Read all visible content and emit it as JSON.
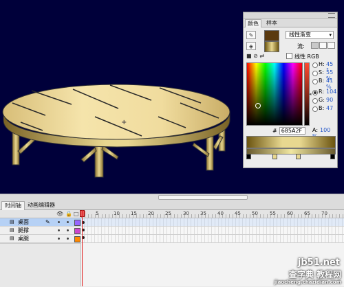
{
  "colors": {
    "stage_bg": "#00003a",
    "table_top_light": "#f2dea0",
    "table_top_dark": "#b79a52",
    "table_outline": "#333333",
    "accent_blue": "#2255c8",
    "playhead": "#e02020"
  },
  "color_panel": {
    "tabs": [
      "颜色",
      "样本"
    ],
    "active_tab": "颜色",
    "stroke_icon": "pencil-icon",
    "fill_icon": "paint-bucket-icon",
    "type_select": "线性渐变",
    "flow_label": "流:",
    "linear_rgb_label": "线性 RGB",
    "hsb": [
      {
        "label": "H:",
        "value": "45",
        "unit": "°"
      },
      {
        "label": "S:",
        "value": "55",
        "unit": "%"
      },
      {
        "label": "B:",
        "value": "41",
        "unit": "%"
      }
    ],
    "rgb": [
      {
        "label": "R:",
        "value": "104",
        "selected": true
      },
      {
        "label": "G:",
        "value": "90"
      },
      {
        "label": "B:",
        "value": "47"
      }
    ],
    "hex_label": "#",
    "hex_value": "685A2F",
    "alpha_label": "A:",
    "alpha_value": "100",
    "alpha_unit": "%"
  },
  "timeline": {
    "tabs": [
      "时间轴",
      "动画编辑器"
    ],
    "active_tab": "时间轴",
    "frame_numbers": [
      "5",
      "10",
      "15",
      "20",
      "25",
      "30",
      "35",
      "40",
      "45",
      "50",
      "55",
      "60",
      "65",
      "70"
    ],
    "current_frame": "1",
    "layers": [
      {
        "name": "桌面",
        "selected": true,
        "color": "#9966ff"
      },
      {
        "name": "腿撑",
        "selected": false,
        "color": "#cc44cc"
      },
      {
        "name": "桌腿",
        "selected": false,
        "color": "#ff8800"
      }
    ]
  },
  "watermark": {
    "line1": "jb51.net",
    "line2": "查字典 教程网",
    "line3": "jiaocheng.chazidian.com"
  }
}
